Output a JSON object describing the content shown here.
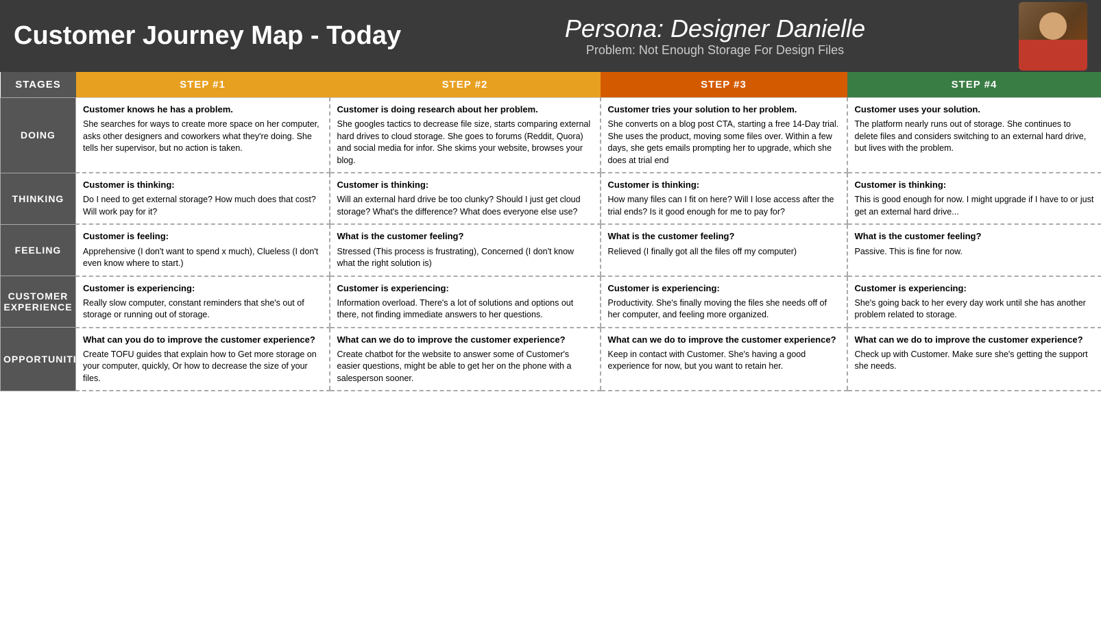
{
  "header": {
    "title": "Customer Journey Map - Today",
    "persona_label": "Persona: Designer Danielle",
    "problem_label": "Problem: Not Enough Storage For Design Files"
  },
  "steps": {
    "stages_label": "STAGES",
    "step1_label": "STEP #1",
    "step2_label": "STEP #2",
    "step3_label": "STEP #3",
    "step4_label": "STEP #4"
  },
  "rows": {
    "doing": {
      "label": "DOING",
      "step1_heading": "Customer knows he has a problem.",
      "step1_body": " She searches for ways to create more space on her computer, asks other designers and coworkers what they're doing. She tells her supervisor, but no action is taken.",
      "step2_heading": "Customer is doing research about her problem.",
      "step2_body": " She googles tactics to decrease file size, starts comparing external hard drives to cloud storage. She goes to forums (Reddit, Quora) and social media for infor. She skims your website, browses your blog.",
      "step3_heading": "Customer tries your solution to her problem.",
      "step3_body": " She converts on a blog post CTA, starting a free 14-Day trial. She uses the product, moving some files over. Within a few days, she gets emails prompting her to upgrade, which she does at trial end",
      "step4_heading": "Customer uses your solution.",
      "step4_body": " The platform nearly runs out of storage. She continues to delete files and considers switching to an external hard drive, but lives with the problem."
    },
    "thinking": {
      "label": "THINKING",
      "step1_heading": "Customer is thinking:",
      "step1_body": "Do I need to get external storage? How much does that cost? Will work pay for it?",
      "step2_heading": "Customer is thinking:",
      "step2_body": "Will an external hard drive be too clunky? Should I just get cloud storage? What's the difference? What does everyone else use?",
      "step3_heading": "Customer is thinking:",
      "step3_body": "How many files can I fit on here? Will I lose access after the trial ends? Is it good enough for me to pay for?",
      "step4_heading": "Customer is thinking:",
      "step4_body": "This is good enough for now. I might upgrade if I have to or just get an external hard drive..."
    },
    "feeling": {
      "label": "FEELING",
      "step1_heading": "Customer is feeling:",
      "step1_body": "Apprehensive (I don't want to spend x much), Clueless (I don't even know where to start.)",
      "step2_heading": "What is the customer feeling?",
      "step2_body": "Stressed (This process is frustrating), Concerned (I don't know what the right solution is)",
      "step3_heading": "What is the customer feeling?",
      "step3_body": "Relieved (I finally got all the files off my computer)",
      "step4_heading": "What is the customer feeling?",
      "step4_body": "Passive. This is fine for now."
    },
    "cx": {
      "label": "CUSTOMER EXPERIENCE",
      "step1_heading": "Customer is experiencing:",
      "step1_body": "Really slow computer, constant reminders that she's out of storage or running out of storage.",
      "step2_heading": "Customer is experiencing:",
      "step2_body": "Information overload. There's a lot of solutions and options out there, not finding immediate answers to her questions.",
      "step3_heading": "Customer is experiencing:",
      "step3_body": "Productivity. She's finally moving the files she needs off of her computer, and feeling more organized.",
      "step4_heading": "Customer is experiencing:",
      "step4_body": "She's going back to her every day work until she has another problem related to storage."
    },
    "opportunities": {
      "label": "OPPORTUNITIES",
      "step1_heading": "What can you do to improve the customer experience?",
      "step1_body": "Create TOFU guides that explain how to Get more storage on your computer, quickly, Or how to decrease the size of your files.",
      "step2_heading": "What can we do to improve the customer experience?",
      "step2_body": "Create chatbot for the website to answer some of Customer's easier questions, might be able to get her on the phone with a salesperson sooner.",
      "step3_heading": "What can we do to improve the customer experience?",
      "step3_body": "Keep in contact with Customer. She's having a good experience for now, but you want to retain her.",
      "step4_heading": "What can we do to improve the customer experience?",
      "step4_body": "Check up with Customer. Make sure she's getting the support she needs."
    }
  }
}
